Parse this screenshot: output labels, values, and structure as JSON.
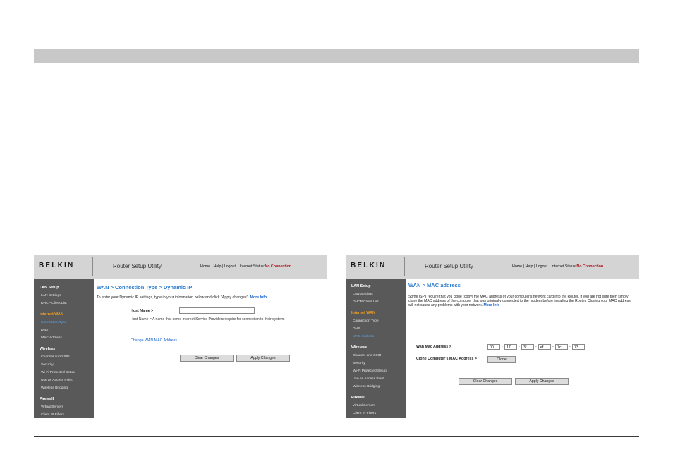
{
  "common": {
    "brand": "BELKIN",
    "trademark": ".",
    "app_title": "Router Setup Utility",
    "nav": {
      "home": "Home",
      "help": "Help",
      "logout": "Logout",
      "sep": "|",
      "status_label": "Internet Status:",
      "status_value": "No Connection"
    },
    "sidebar": {
      "lan_setup": "LAN Setup",
      "lan_settings": "LAN Settings",
      "dhcp_client_list": "DHCP Client List",
      "internet_wan": "Internet WAN",
      "connection_type": "Connection Type",
      "dns": "DNS",
      "mac_address": "MAC Address",
      "wireless": "Wireless",
      "channel_ssid": "Channel and SSID",
      "security": "Security",
      "wps": "Wi-Fi Protected Setup",
      "access_point": "Use as Access Point",
      "bridging": "Wireless Bridging",
      "firewall": "Firewall",
      "virtual_servers": "Virtual Servers",
      "client_ip_filters": "Client IP Filters"
    },
    "status_color": "#b0101a",
    "accent_color": "#2b7bcc"
  },
  "left": {
    "title": "WAN > Connection Type > Dynamic IP",
    "intro": "To enter your Dynamic IP settings, type in your information below and click \"Apply changes\".",
    "more_info": "More Info",
    "host_name_label": "Host Name >",
    "host_name_value": "",
    "help_text": "Host Name = A name that some Internet Service Providers require for connection to their system.",
    "change_mac_link": "Change WAN MAC Address",
    "clear_button": "Clear Changes",
    "apply_button": "Apply Changes"
  },
  "right": {
    "title": "WAN > MAC address",
    "paragraph": "Some ISPs require that you clone (copy) the MAC address of your computer's network card into the Router. If you are not sure then simply clone the MAC address of the computer that was originally connected to the modem before installing the Router. Cloning your MAC address will not cause any problems with your network.",
    "more_info": "More Info",
    "wan_mac_label": "Wan Mac Address >",
    "mac_octets": [
      "00",
      "17",
      "3f",
      "ef",
      "7c",
      "73"
    ],
    "mac_separator": "-",
    "clone_label": "Clone Computer's MAC Address >",
    "clone_button": "Clone",
    "clear_button": "Clear Changes",
    "apply_button": "Apply Changes"
  }
}
